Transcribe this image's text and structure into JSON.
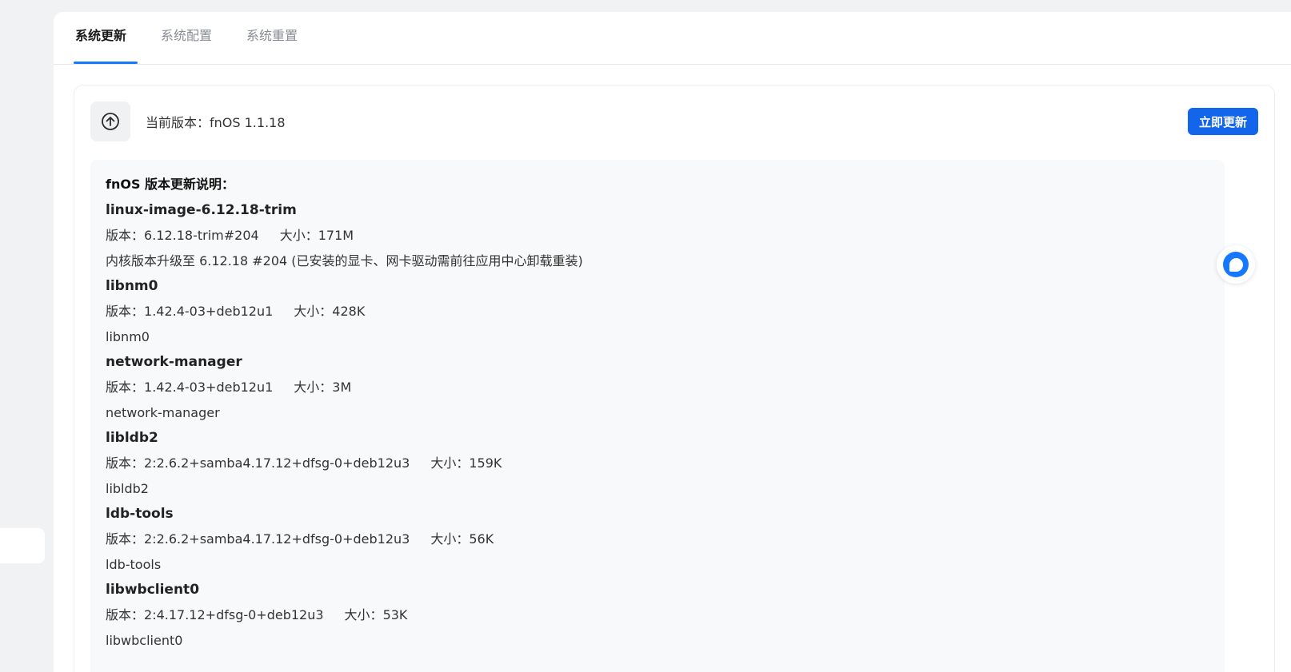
{
  "tabs": [
    {
      "label": "系统更新",
      "active": true
    },
    {
      "label": "系统配置",
      "active": false
    },
    {
      "label": "系统重置",
      "active": false
    }
  ],
  "version": {
    "label": "当前版本：",
    "value": "fnOS 1.1.18",
    "icon": "arrow-up-circle-icon"
  },
  "update_button": {
    "label": "立即更新"
  },
  "notes": {
    "title": "fnOS 版本更新说明：",
    "version_prefix": "版本：",
    "size_prefix": "大小：",
    "packages": [
      {
        "name": "linux-image-6.12.18-trim",
        "version": "6.12.18-trim#204",
        "size": "171M",
        "description": "内核版本升级至 6.12.18 #204 (已安装的显卡、网卡驱动需前往应用中心卸载重装)"
      },
      {
        "name": "libnm0",
        "version": "1.42.4-03+deb12u1",
        "size": "428K",
        "description": "libnm0"
      },
      {
        "name": "network-manager",
        "version": "1.42.4-03+deb12u1",
        "size": "3M",
        "description": "network-manager"
      },
      {
        "name": "libldb2",
        "version": "2:2.6.2+samba4.17.12+dfsg-0+deb12u3",
        "size": "159K",
        "description": "libldb2"
      },
      {
        "name": "ldb-tools",
        "version": "2:2.6.2+samba4.17.12+dfsg-0+deb12u3",
        "size": "56K",
        "description": "ldb-tools"
      },
      {
        "name": "libwbclient0",
        "version": "2:4.17.12+dfsg-0+deb12u3",
        "size": "53K",
        "description": "libwbclient0"
      }
    ]
  },
  "colors": {
    "accent": "#1366ec",
    "tab_indicator": "#1677ff",
    "background": "#f1f2f4"
  },
  "floating_assistant": {
    "icon": "chat-bubble-icon"
  }
}
